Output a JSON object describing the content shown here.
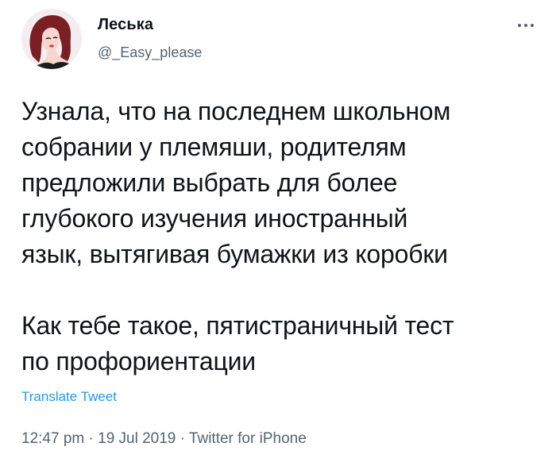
{
  "tweet": {
    "author": {
      "display_name": "Леська",
      "handle": "@_Easy_please",
      "avatar_icon": "user-avatar-illustration"
    },
    "more_icon": "more-options-icon",
    "text": "Узнала, что на последнем школьном\nсобрании у племяши, родителям\nпредложили выбрать для более\nглубокого изучения иностранный\nязык, вытягивая бумажки из коробки\n\nКак тебе такое, пятистраничный тест\nпо профориентации",
    "translate_label": "Translate Tweet",
    "meta": {
      "time": "12:47 pm",
      "separator": "·",
      "date": "19 Jul 2019",
      "source": "Twitter for iPhone"
    },
    "colors": {
      "text": "#0f1419",
      "secondary": "#536471",
      "link": "#1d9bf0"
    }
  }
}
